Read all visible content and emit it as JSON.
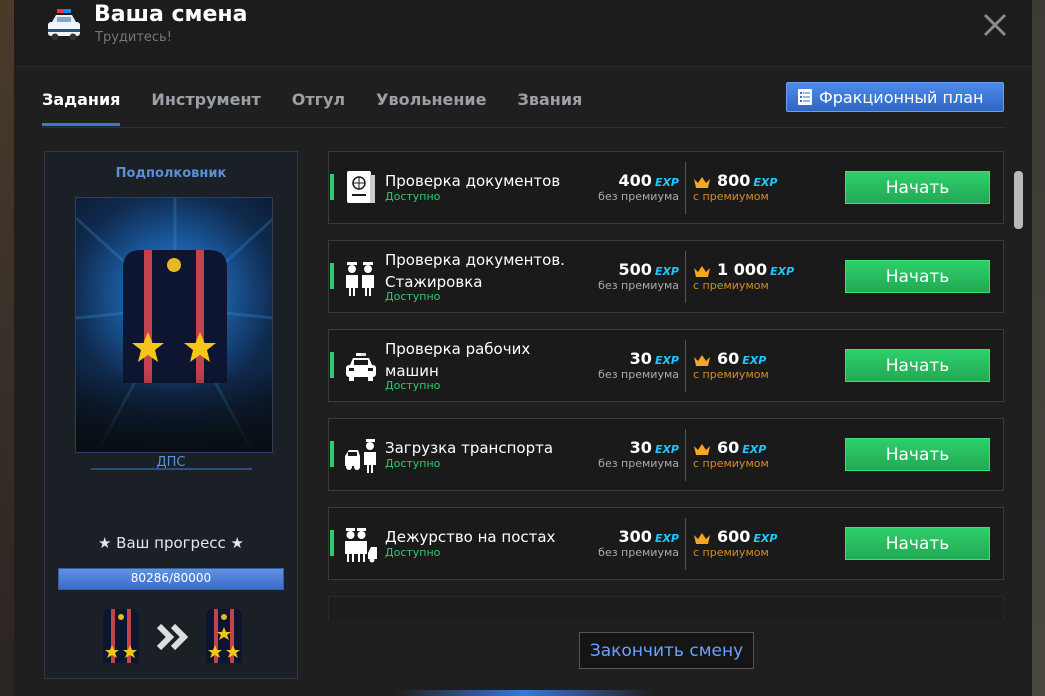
{
  "header": {
    "title": "Ваша смена",
    "subtitle": "Трудитесь!",
    "icon": "police-car-icon"
  },
  "tabs": [
    {
      "label": "Задания",
      "active": true
    },
    {
      "label": "Инструмент",
      "active": false
    },
    {
      "label": "Отгул",
      "active": false
    },
    {
      "label": "Увольнение",
      "active": false
    },
    {
      "label": "Звания",
      "active": false
    }
  ],
  "plan_button": {
    "label": "Фракционный план",
    "icon": "checklist-icon"
  },
  "rank": {
    "title": "Подполковник",
    "department": "ДПС",
    "progress_label": "★ Ваш прогресс ★",
    "progress_text": "80286/80000",
    "progress_fraction": 1.0
  },
  "tasks": [
    {
      "name": "Проверка документов",
      "status": "Доступно",
      "base": "400",
      "premium": "800",
      "exp": "EXP",
      "base_sub": "без премиума",
      "prem_sub": "с премиумом",
      "button": "Начать",
      "icon": "passport-icon"
    },
    {
      "name": "Проверка документов. Стажировка",
      "status": "Доступно",
      "base": "500",
      "premium": "1 000",
      "exp": "EXP",
      "base_sub": "без премиума",
      "prem_sub": "с премиумом",
      "button": "Начать",
      "icon": "officers-icon"
    },
    {
      "name": "Проверка рабочих машин",
      "status": "Доступно",
      "base": "30",
      "premium": "60",
      "exp": "EXP",
      "base_sub": "без премиума",
      "prem_sub": "с премиумом",
      "button": "Начать",
      "icon": "police-car-icon"
    },
    {
      "name": "Загрузка транспорта",
      "status": "Доступно",
      "base": "30",
      "premium": "60",
      "exp": "EXP",
      "base_sub": "без премиума",
      "prem_sub": "с премиумом",
      "button": "Начать",
      "icon": "tow-truck-icon"
    },
    {
      "name": "Дежурство на постах",
      "status": "Доступно",
      "base": "300",
      "premium": "600",
      "exp": "EXP",
      "base_sub": "без премиума",
      "prem_sub": "с премиумом",
      "button": "Начать",
      "icon": "patrol-post-icon"
    }
  ],
  "end_shift_button": "Закончить смену",
  "colors": {
    "accent_blue": "#3a78d8",
    "start_green": "#2ecc71",
    "exp_cyan": "#1ec8ff",
    "premium_orange": "#d88a24"
  }
}
